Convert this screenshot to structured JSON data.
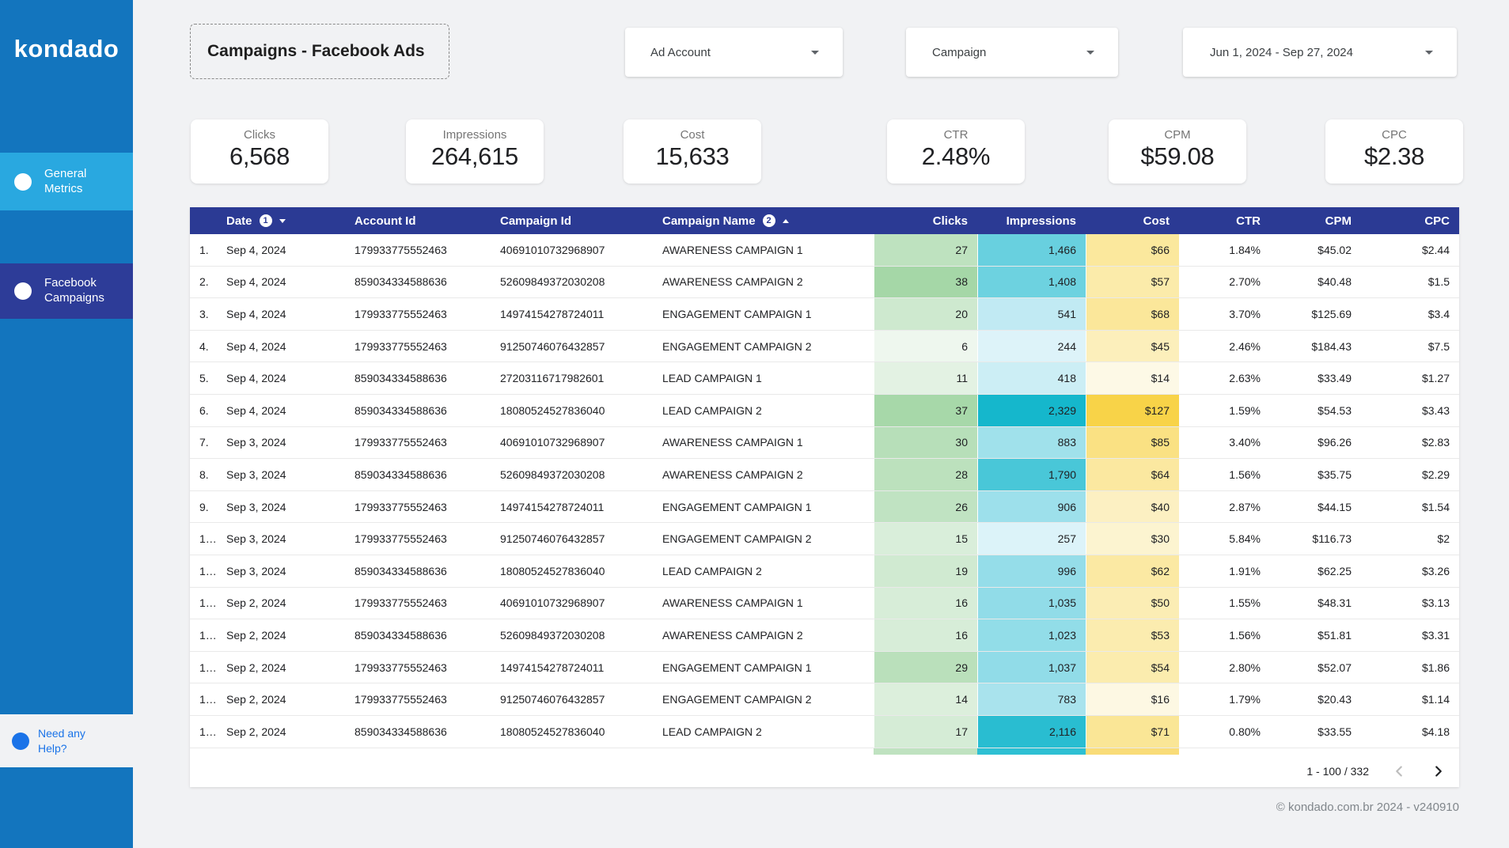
{
  "sidebar": {
    "logo": "kondado",
    "items": [
      {
        "label": "General Metrics"
      },
      {
        "label": "Facebook Campaigns"
      }
    ],
    "help_label": "Need any Help?"
  },
  "header": {
    "title": "Campaigns - Facebook Ads",
    "filters": [
      {
        "label": "Ad Account"
      },
      {
        "label": "Campaign"
      },
      {
        "label": "Jun 1, 2024 - Sep 27, 2024"
      }
    ]
  },
  "scorecards": [
    {
      "label": "Clicks",
      "value": "6,568"
    },
    {
      "label": "Impressions",
      "value": "264,615"
    },
    {
      "label": "Cost",
      "value": "15,633"
    },
    {
      "label": "CTR",
      "value": "2.48%"
    },
    {
      "label": "CPM",
      "value": "$59.08"
    },
    {
      "label": "CPC",
      "value": "$2.38"
    }
  ],
  "table": {
    "columns": [
      "Date",
      "Account Id",
      "Campaign Id",
      "Campaign Name",
      "Clicks",
      "Impressions",
      "Cost",
      "CTR",
      "CPM",
      "CPC"
    ],
    "sort": {
      "date_badge": "1",
      "campaign_badge": "2"
    },
    "rows": [
      {
        "n": "1.",
        "date": "Sep 4, 2024",
        "account_id": "179933775552463",
        "campaign_id": "40691010732968907",
        "campaign_name": "AWARENESS CAMPAIGN 1",
        "clicks": 27,
        "impressions": 1466,
        "cost": 66,
        "ctr": "1.84%",
        "cpm": "$45.02",
        "cpc": "$2.44"
      },
      {
        "n": "2.",
        "date": "Sep 4, 2024",
        "account_id": "859034334588636",
        "campaign_id": "52609849372030208",
        "campaign_name": "AWARENESS CAMPAIGN 2",
        "clicks": 38,
        "impressions": 1408,
        "cost": 57,
        "ctr": "2.70%",
        "cpm": "$40.48",
        "cpc": "$1.5"
      },
      {
        "n": "3.",
        "date": "Sep 4, 2024",
        "account_id": "179933775552463",
        "campaign_id": "14974154278724011",
        "campaign_name": "ENGAGEMENT CAMPAIGN 1",
        "clicks": 20,
        "impressions": 541,
        "cost": 68,
        "ctr": "3.70%",
        "cpm": "$125.69",
        "cpc": "$3.4"
      },
      {
        "n": "4.",
        "date": "Sep 4, 2024",
        "account_id": "179933775552463",
        "campaign_id": "91250746076432857",
        "campaign_name": "ENGAGEMENT CAMPAIGN 2",
        "clicks": 6,
        "impressions": 244,
        "cost": 45,
        "ctr": "2.46%",
        "cpm": "$184.43",
        "cpc": "$7.5"
      },
      {
        "n": "5.",
        "date": "Sep 4, 2024",
        "account_id": "859034334588636",
        "campaign_id": "27203116717982601",
        "campaign_name": "LEAD CAMPAIGN 1",
        "clicks": 11,
        "impressions": 418,
        "cost": 14,
        "ctr": "2.63%",
        "cpm": "$33.49",
        "cpc": "$1.27"
      },
      {
        "n": "6.",
        "date": "Sep 4, 2024",
        "account_id": "859034334588636",
        "campaign_id": "18080524527836040",
        "campaign_name": "LEAD CAMPAIGN 2",
        "clicks": 37,
        "impressions": 2329,
        "cost": 127,
        "ctr": "1.59%",
        "cpm": "$54.53",
        "cpc": "$3.43"
      },
      {
        "n": "7.",
        "date": "Sep 3, 2024",
        "account_id": "179933775552463",
        "campaign_id": "40691010732968907",
        "campaign_name": "AWARENESS CAMPAIGN 1",
        "clicks": 30,
        "impressions": 883,
        "cost": 85,
        "ctr": "3.40%",
        "cpm": "$96.26",
        "cpc": "$2.83"
      },
      {
        "n": "8.",
        "date": "Sep 3, 2024",
        "account_id": "859034334588636",
        "campaign_id": "52609849372030208",
        "campaign_name": "AWARENESS CAMPAIGN 2",
        "clicks": 28,
        "impressions": 1790,
        "cost": 64,
        "ctr": "1.56%",
        "cpm": "$35.75",
        "cpc": "$2.29"
      },
      {
        "n": "9.",
        "date": "Sep 3, 2024",
        "account_id": "179933775552463",
        "campaign_id": "14974154278724011",
        "campaign_name": "ENGAGEMENT CAMPAIGN 1",
        "clicks": 26,
        "impressions": 906,
        "cost": 40,
        "ctr": "2.87%",
        "cpm": "$44.15",
        "cpc": "$1.54"
      },
      {
        "n": "1…",
        "date": "Sep 3, 2024",
        "account_id": "179933775552463",
        "campaign_id": "91250746076432857",
        "campaign_name": "ENGAGEMENT CAMPAIGN 2",
        "clicks": 15,
        "impressions": 257,
        "cost": 30,
        "ctr": "5.84%",
        "cpm": "$116.73",
        "cpc": "$2"
      },
      {
        "n": "1…",
        "date": "Sep 3, 2024",
        "account_id": "859034334588636",
        "campaign_id": "18080524527836040",
        "campaign_name": "LEAD CAMPAIGN 2",
        "clicks": 19,
        "impressions": 996,
        "cost": 62,
        "ctr": "1.91%",
        "cpm": "$62.25",
        "cpc": "$3.26"
      },
      {
        "n": "1…",
        "date": "Sep 2, 2024",
        "account_id": "179933775552463",
        "campaign_id": "40691010732968907",
        "campaign_name": "AWARENESS CAMPAIGN 1",
        "clicks": 16,
        "impressions": 1035,
        "cost": 50,
        "ctr": "1.55%",
        "cpm": "$48.31",
        "cpc": "$3.13"
      },
      {
        "n": "1…",
        "date": "Sep 2, 2024",
        "account_id": "859034334588636",
        "campaign_id": "52609849372030208",
        "campaign_name": "AWARENESS CAMPAIGN 2",
        "clicks": 16,
        "impressions": 1023,
        "cost": 53,
        "ctr": "1.56%",
        "cpm": "$51.81",
        "cpc": "$3.31"
      },
      {
        "n": "1…",
        "date": "Sep 2, 2024",
        "account_id": "179933775552463",
        "campaign_id": "14974154278724011",
        "campaign_name": "ENGAGEMENT CAMPAIGN 1",
        "clicks": 29,
        "impressions": 1037,
        "cost": 54,
        "ctr": "2.80%",
        "cpm": "$52.07",
        "cpc": "$1.86"
      },
      {
        "n": "1…",
        "date": "Sep 2, 2024",
        "account_id": "179933775552463",
        "campaign_id": "91250746076432857",
        "campaign_name": "ENGAGEMENT CAMPAIGN 2",
        "clicks": 14,
        "impressions": 783,
        "cost": 16,
        "ctr": "1.79%",
        "cpm": "$20.43",
        "cpc": "$1.14"
      },
      {
        "n": "1…",
        "date": "Sep 2, 2024",
        "account_id": "859034334588636",
        "campaign_id": "18080524527836040",
        "campaign_name": "LEAD CAMPAIGN 2",
        "clicks": 17,
        "impressions": 2116,
        "cost": 71,
        "ctr": "0.80%",
        "cpm": "$33.55",
        "cpc": "$4.18"
      }
    ]
  },
  "pagination": {
    "label": "1 - 100 / 332"
  },
  "footer": {
    "copyright": "© kondado.com.br 2024 - v240910"
  },
  "theme": {
    "sidebar_blue": "#1375be",
    "nav_active_blue": "#29a8e0",
    "nav_navy": "#2d3c98",
    "table_header_navy": "#2b3a94",
    "help_blue": "#1a73e8",
    "page_bg": "#f1f2f4",
    "heat_green": [
      "#eef7ee",
      "#a5d7a7"
    ],
    "heat_cyan": [
      "#ddf3f9",
      "#15b7cc"
    ],
    "heat_yellow": [
      "#fdf9e6",
      "#f8d348"
    ],
    "partial_row_colors": [
      "#bfe2c0",
      "#2ec0d3",
      "#f9dc78"
    ]
  }
}
